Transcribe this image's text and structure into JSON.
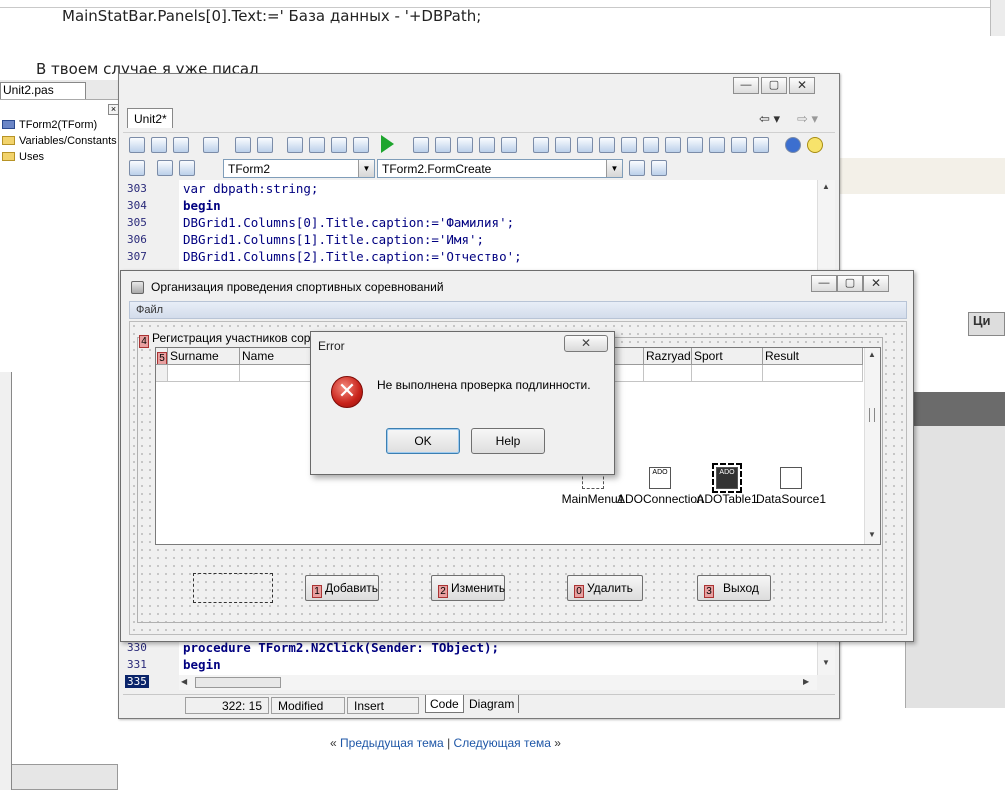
{
  "background_page": {
    "code_line": "MainStatBar.Panels[0].Text:=' База данных - '+DBPath;",
    "text_line": "В твоем случае я уже писал",
    "nav": {
      "prev_marker": "«",
      "prev_label": "Предыдущая тема",
      "separator": "|",
      "next_label": "Следующая тема",
      "next_marker": "»"
    },
    "logo_text": "Ци"
  },
  "left_panel": {
    "tab_label": "Unit2.pas",
    "close_glyph": "×",
    "tree": [
      "TForm2(TForm)",
      "Variables/Constants",
      "Uses"
    ]
  },
  "ide": {
    "editor_tab": "Unit2*",
    "combo_class": "TForm2",
    "combo_method": "TForm2.FormCreate",
    "lines_top": [
      {
        "num": "303",
        "code": "var dbpath:string;"
      },
      {
        "num": "304",
        "code": "begin"
      },
      {
        "num": "305",
        "code": "DBGrid1.Columns[0].Title.caption:='Фамилия';"
      },
      {
        "num": "306",
        "code": "DBGrid1.Columns[1].Title.caption:='Имя';"
      },
      {
        "num": "307",
        "code": "DBGrid1.Columns[2].Title.caption:='Отчество';"
      }
    ],
    "lines_bottom": [
      {
        "num": "330",
        "code": "procedure TForm2.N2Click(Sender: TObject);"
      },
      {
        "num": "331",
        "code": "begin"
      },
      {
        "num": "335",
        "code": ""
      }
    ],
    "status": {
      "position": "322: 15",
      "modified": "Modified",
      "mode": "Insert",
      "tab_code": "Code",
      "tab_diagram": "Diagram"
    }
  },
  "form": {
    "title": "Организация проведения спортивных соревнований",
    "menu_file": "Файл",
    "group_caption": "Регистрация участников соревн",
    "grid_badge": "5",
    "grid_columns_left": [
      "Surname",
      "Name"
    ],
    "grid_columns_right": [
      "Razryad",
      "Sport",
      "Result"
    ],
    "components": [
      "MainMenu1",
      "ADOConnection",
      "ADOTable1",
      "DataSource1"
    ],
    "buttons": [
      {
        "badge": "1",
        "label": "Добавить"
      },
      {
        "badge": "2",
        "label": "Изменить"
      },
      {
        "badge": "0",
        "label": "Удалить"
      },
      {
        "badge": "3",
        "label": "Выход"
      }
    ]
  },
  "dialog": {
    "title": "Error",
    "close_glyph": "✕",
    "message": "Не выполнена проверка подлинности.",
    "ok_label": "OK",
    "help_label": "Help"
  }
}
